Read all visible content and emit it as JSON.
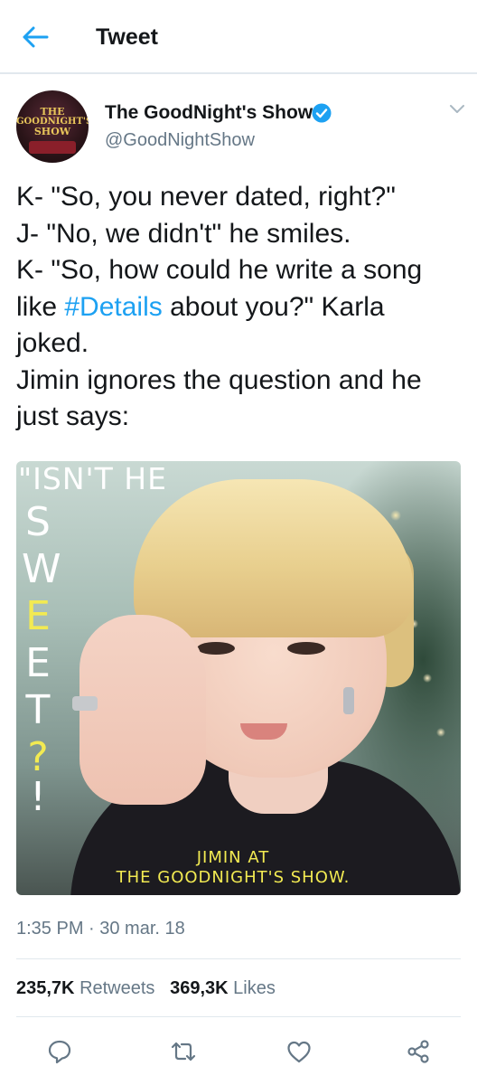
{
  "header": {
    "title": "Tweet",
    "back_icon": "arrow-left-icon",
    "accent": "#1da1f2"
  },
  "author": {
    "display_name": "The GoodNight's Show",
    "handle": "@GoodNightShow",
    "verified": true,
    "avatar_text": [
      "THE",
      "GOODNIGHT'S",
      "SHOW"
    ]
  },
  "tweet": {
    "lines": [
      {
        "text": "K- \"So, you never dated, right?\""
      },
      {
        "text": "J- \"No, we didn't\" he smiles."
      },
      {
        "text": "K- \"So, how could he write a song"
      },
      {
        "before": "like ",
        "hashtag": "#Details",
        "after": " about you?\" Karla"
      },
      {
        "text": "joked."
      },
      {
        "text": "Jimin ignores the question and he"
      },
      {
        "text": "just says:"
      }
    ]
  },
  "media": {
    "overlay_top": "\"ISN'T HE",
    "sweet_letters": [
      "S",
      "W",
      "E",
      "E",
      "T",
      "?",
      "!"
    ],
    "caption_line1": "JIMIN AT",
    "caption_line2": "THE GOODNIGHT'S SHOW."
  },
  "timestamp": "1:35 PM · 30 mar. 18",
  "stats": {
    "retweets_count": "235,7K",
    "retweets_label": "Retweets",
    "likes_count": "369,3K",
    "likes_label": "Likes"
  },
  "actions": [
    "reply-icon",
    "retweet-icon",
    "heart-icon",
    "share-icon"
  ],
  "colors": {
    "text": "#14171a",
    "secondary": "#657786",
    "link": "#1da1f2",
    "caption_yellow": "#f2ea52"
  }
}
